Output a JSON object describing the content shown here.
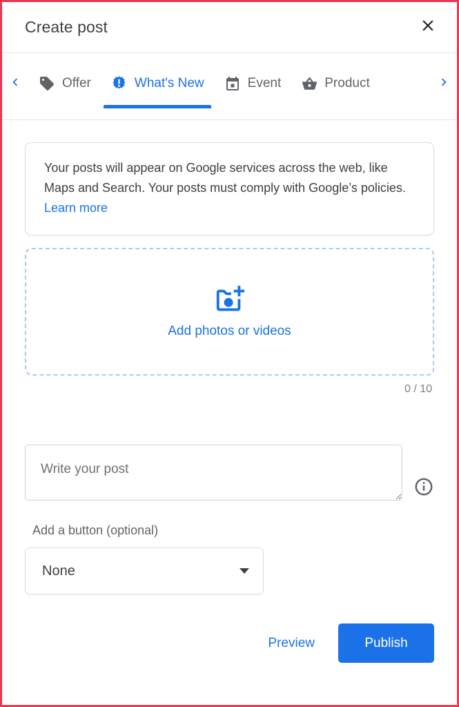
{
  "header": {
    "title": "Create post",
    "close_icon": "close-icon"
  },
  "tabstrip": {
    "prev_icon": "chevron-left-icon",
    "next_icon": "chevron-right-icon",
    "tabs": [
      {
        "label": "Offer",
        "icon": "tag-icon",
        "active": false
      },
      {
        "label": "What's New",
        "icon": "badge-alert-icon",
        "active": true
      },
      {
        "label": "Event",
        "icon": "calendar-icon",
        "active": false
      },
      {
        "label": "Product",
        "icon": "basket-icon",
        "active": false
      }
    ]
  },
  "notice": {
    "text": "Your posts will appear on Google services across the web, like Maps and Search. Your posts must comply with Google’s policies. ",
    "link_label": "Learn more"
  },
  "media": {
    "icon": "camera-plus-icon",
    "label": "Add photos or videos",
    "counter": "0 / 10"
  },
  "post": {
    "value": "",
    "placeholder": "Write your post",
    "info_icon": "info-circle-icon"
  },
  "button_field": {
    "label": "Add a button (optional)",
    "selected": "None",
    "caret_icon": "chevron-down-icon"
  },
  "footer": {
    "preview_label": "Preview",
    "publish_label": "Publish"
  },
  "colors": {
    "accent": "#1b72e8",
    "frame": "#e8374f",
    "text": "#3c4043",
    "muted": "#5f6368",
    "dropzone_border": "#aac9f5"
  }
}
